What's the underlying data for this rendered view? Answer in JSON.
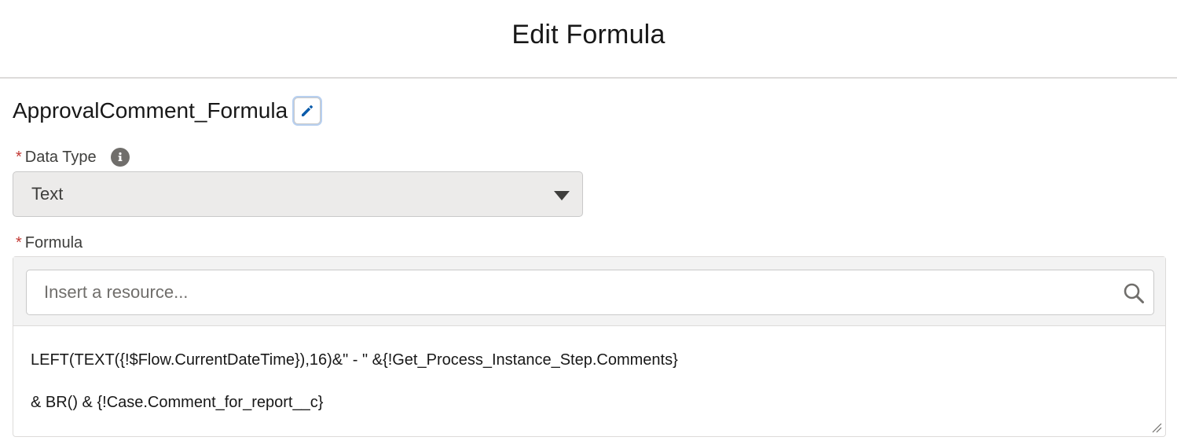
{
  "header": {
    "title": "Edit Formula"
  },
  "resource": {
    "api_name": "ApprovalComment_Formula",
    "edit_icon": "pencil-icon"
  },
  "data_type": {
    "required_marker": "*",
    "label": "Data Type",
    "info_icon": "info-icon",
    "selected_value": "Text"
  },
  "formula": {
    "required_marker": "*",
    "label": "Formula",
    "search_placeholder": "Insert a resource...",
    "search_icon": "search-icon",
    "lines": [
      "LEFT(TEXT({!$Flow.CurrentDateTime}),16)&\" - \" &{!Get_Process_Instance_Step.Comments}",
      "& BR() & {!Case.Comment_for_report__c}"
    ]
  },
  "colors": {
    "required": "#c23934",
    "edit_icon": "#0b5cab",
    "select_bg": "#ecebea",
    "toolbar_bg": "#f3f3f3"
  }
}
